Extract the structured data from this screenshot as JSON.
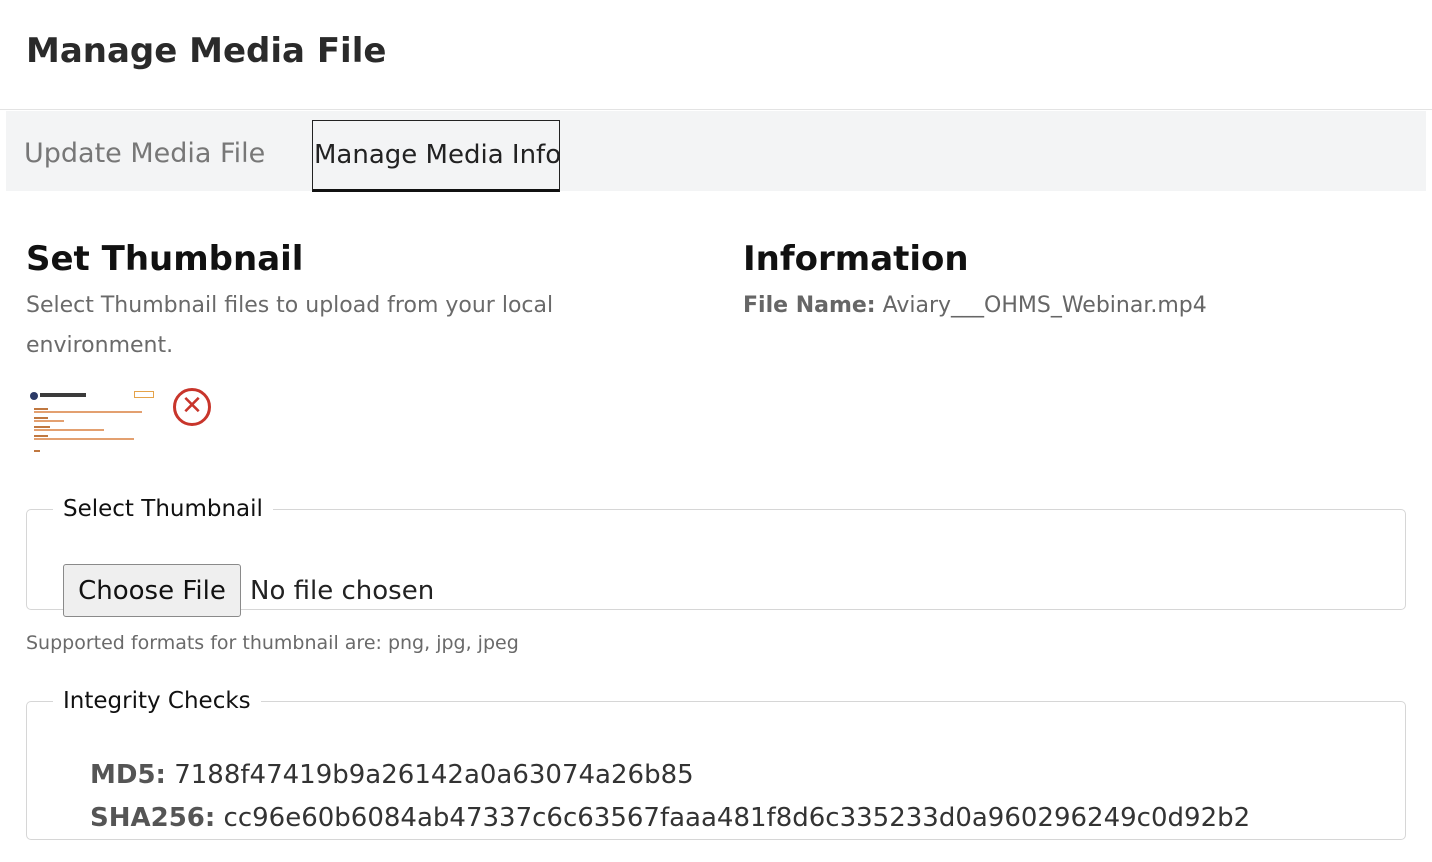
{
  "header": {
    "title": "Manage Media File"
  },
  "tabs": [
    {
      "label": "Update Media File",
      "active": false
    },
    {
      "label": "Manage Media Info",
      "active": true
    }
  ],
  "thumbnail_section": {
    "heading": "Set Thumbnail",
    "help": "Select Thumbnail files to upload from your local environment.",
    "remove_icon": "close-circle-icon",
    "fieldset_legend": "Select Thumbnail",
    "choose_button": "Choose File",
    "file_status": "No file chosen",
    "formats_note": "Supported formats for thumbnail are: png, jpg, jpeg"
  },
  "information": {
    "heading": "Information",
    "file_name_label": "File Name:",
    "file_name_value": "Aviary___OHMS_Webinar.mp4"
  },
  "integrity": {
    "legend": "Integrity Checks",
    "md5_label": "MD5:",
    "md5_value": "7188f47419b9a26142a0a63074a26b85",
    "sha256_label": "SHA256:",
    "sha256_value": "cc96e60b6084ab47337c6c63567faaa481f8d6c335233d0a960296249c0d92b2"
  },
  "colors": {
    "tab_bar_bg": "#f3f4f5",
    "remove_icon": "#c8352b",
    "muted_text": "#6a6a6a"
  }
}
